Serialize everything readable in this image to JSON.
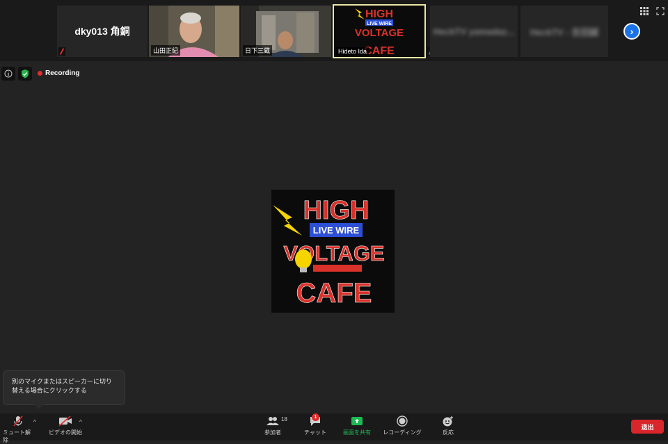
{
  "gallery": {
    "tiles": [
      {
        "name": "dky013 角銅"
      },
      {
        "name": "山田正紀"
      },
      {
        "name": "日下三蔵"
      },
      {
        "name": "Hideto Ida"
      },
      {
        "name": "HeckTV yamadaz..."
      },
      {
        "name": "HeckTV - 吉田誠"
      }
    ]
  },
  "status": {
    "recording_label": "Recording"
  },
  "share": {
    "logo_lines": [
      "HIGH",
      "LIVE WIRE",
      "VOLTAGE",
      "CAFE"
    ],
    "colors": {
      "red": "#d8322a",
      "blue": "#2d4fd6",
      "yellow": "#f5d400"
    }
  },
  "tooltip": {
    "text": "別のマイクまたはスピーカーに切り替える場合にクリックする"
  },
  "toolbar": {
    "mute_label": "ミュート解除",
    "video_label": "ビデオの開始",
    "participants_label": "参加者",
    "participants_count": "18",
    "chat_label": "チャット",
    "chat_badge": "1",
    "share_label": "画面を共有",
    "record_label": "レコーディング",
    "reactions_label": "反応",
    "leave_label": "退出"
  },
  "colors": {
    "share_green": "#1db954",
    "leave_red": "#d9262b",
    "nav_blue": "#1a73e8"
  }
}
